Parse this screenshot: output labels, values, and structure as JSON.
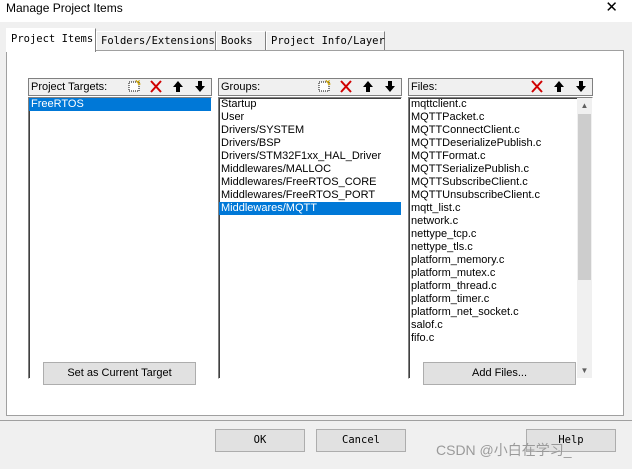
{
  "window": {
    "title": "Manage Project Items",
    "close_glyph": "✕"
  },
  "tabs": [
    {
      "label": "Project Items",
      "active": true
    },
    {
      "label": "Folders/Extensions",
      "active": false
    },
    {
      "label": "Books",
      "active": false
    },
    {
      "label": "Project Info/Layer",
      "active": false
    }
  ],
  "targets": {
    "label": "Project Targets:",
    "items": [
      "FreeRTOS"
    ],
    "selected": "FreeRTOS",
    "toolbar_icons": [
      "new-icon",
      "delete-icon",
      "move-up-icon",
      "move-down-icon"
    ]
  },
  "groups": {
    "label": "Groups:",
    "items": [
      "Startup",
      "User",
      "Drivers/SYSTEM",
      "Drivers/BSP",
      "Drivers/STM32F1xx_HAL_Driver",
      "Middlewares/MALLOC",
      "Middlewares/FreeRTOS_CORE",
      "Middlewares/FreeRTOS_PORT",
      "Middlewares/MQTT"
    ],
    "selected": "Middlewares/MQTT",
    "toolbar_icons": [
      "new-icon",
      "delete-icon",
      "move-up-icon",
      "move-down-icon"
    ]
  },
  "files": {
    "label": "Files:",
    "items": [
      "mqttclient.c",
      "MQTTPacket.c",
      "MQTTConnectClient.c",
      "MQTTDeserializePublish.c",
      "MQTTFormat.c",
      "MQTTSerializePublish.c",
      "MQTTSubscribeClient.c",
      "MQTTUnsubscribeClient.c",
      "mqtt_list.c",
      "network.c",
      "nettype_tcp.c",
      "nettype_tls.c",
      "platform_memory.c",
      "platform_mutex.c",
      "platform_thread.c",
      "platform_timer.c",
      "platform_net_socket.c",
      "salof.c",
      "fifo.c"
    ],
    "toolbar_icons": [
      "delete-icon",
      "move-up-icon",
      "move-down-icon"
    ]
  },
  "buttons": {
    "set_current_target": "Set as Current Target",
    "add_files": "Add Files...",
    "ok": "OK",
    "cancel": "Cancel",
    "help": "Help"
  },
  "watermark": "CSDN @小白在学习_",
  "colors": {
    "selection": "#0078d7",
    "delete_icon": "#d00000"
  }
}
